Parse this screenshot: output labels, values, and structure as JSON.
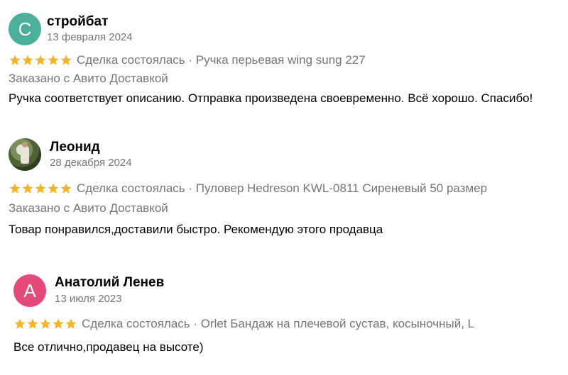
{
  "colors": {
    "star": "#f5b52a",
    "meta": "#757575",
    "avatar_c": "#4caf9a",
    "avatar_a": "#e5487a"
  },
  "reviews": [
    {
      "avatar_letter": "С",
      "name": "стройбат",
      "date": "13 февраля 2024",
      "rating": 5,
      "deal": "Сделка состоялась · Ручка перьевая wing sung 227",
      "delivery": "Заказано с Авито Доставкой",
      "text": "Ручка соответствует описанию. Отправка произведена своевременно. Всё хорошо. Спасибо!"
    },
    {
      "avatar_letter": "",
      "name": "Леонид",
      "date": "28 декабря 2024",
      "rating": 5,
      "deal": "Сделка состоялась · Пуловер Hedreson KWL-0811 Сиреневый 50 размер",
      "delivery": "Заказано с Авито Доставкой",
      "text": "Товар понравился,доставили быстро. Рекомендую этого продавца"
    },
    {
      "avatar_letter": "А",
      "name": "Анатолий Ленев",
      "date": "13 июля 2023",
      "rating": 5,
      "deal": "Сделка состоялась · Orlet Бандаж на плечевой сустав, косыночный, L",
      "text": "Все отлично,продавец на высоте)"
    }
  ]
}
